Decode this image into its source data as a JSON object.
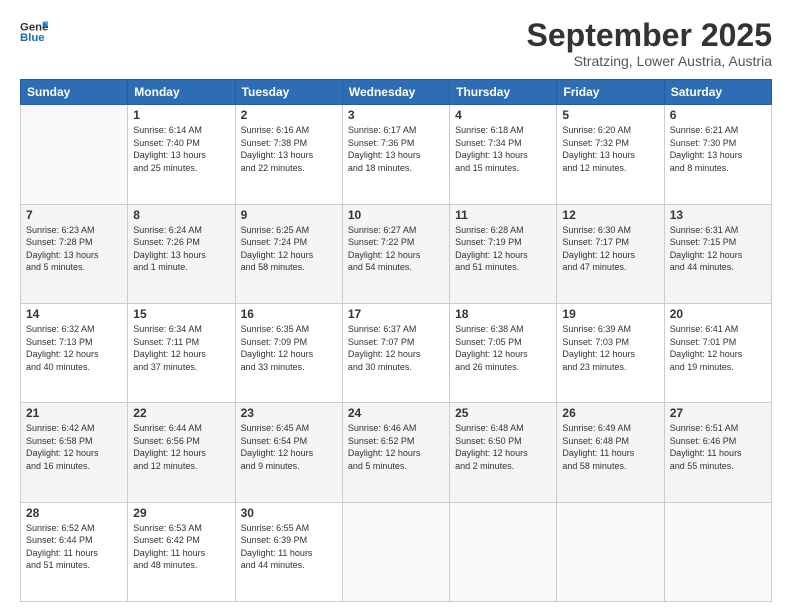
{
  "logo": {
    "line1": "General",
    "line2": "Blue"
  },
  "header": {
    "month": "September 2025",
    "location": "Stratzing, Lower Austria, Austria"
  },
  "weekdays": [
    "Sunday",
    "Monday",
    "Tuesday",
    "Wednesday",
    "Thursday",
    "Friday",
    "Saturday"
  ],
  "weeks": [
    [
      {
        "day": "",
        "info": ""
      },
      {
        "day": "1",
        "info": "Sunrise: 6:14 AM\nSunset: 7:40 PM\nDaylight: 13 hours\nand 25 minutes."
      },
      {
        "day": "2",
        "info": "Sunrise: 6:16 AM\nSunset: 7:38 PM\nDaylight: 13 hours\nand 22 minutes."
      },
      {
        "day": "3",
        "info": "Sunrise: 6:17 AM\nSunset: 7:36 PM\nDaylight: 13 hours\nand 18 minutes."
      },
      {
        "day": "4",
        "info": "Sunrise: 6:18 AM\nSunset: 7:34 PM\nDaylight: 13 hours\nand 15 minutes."
      },
      {
        "day": "5",
        "info": "Sunrise: 6:20 AM\nSunset: 7:32 PM\nDaylight: 13 hours\nand 12 minutes."
      },
      {
        "day": "6",
        "info": "Sunrise: 6:21 AM\nSunset: 7:30 PM\nDaylight: 13 hours\nand 8 minutes."
      }
    ],
    [
      {
        "day": "7",
        "info": "Sunrise: 6:23 AM\nSunset: 7:28 PM\nDaylight: 13 hours\nand 5 minutes."
      },
      {
        "day": "8",
        "info": "Sunrise: 6:24 AM\nSunset: 7:26 PM\nDaylight: 13 hours\nand 1 minute."
      },
      {
        "day": "9",
        "info": "Sunrise: 6:25 AM\nSunset: 7:24 PM\nDaylight: 12 hours\nand 58 minutes."
      },
      {
        "day": "10",
        "info": "Sunrise: 6:27 AM\nSunset: 7:22 PM\nDaylight: 12 hours\nand 54 minutes."
      },
      {
        "day": "11",
        "info": "Sunrise: 6:28 AM\nSunset: 7:19 PM\nDaylight: 12 hours\nand 51 minutes."
      },
      {
        "day": "12",
        "info": "Sunrise: 6:30 AM\nSunset: 7:17 PM\nDaylight: 12 hours\nand 47 minutes."
      },
      {
        "day": "13",
        "info": "Sunrise: 6:31 AM\nSunset: 7:15 PM\nDaylight: 12 hours\nand 44 minutes."
      }
    ],
    [
      {
        "day": "14",
        "info": "Sunrise: 6:32 AM\nSunset: 7:13 PM\nDaylight: 12 hours\nand 40 minutes."
      },
      {
        "day": "15",
        "info": "Sunrise: 6:34 AM\nSunset: 7:11 PM\nDaylight: 12 hours\nand 37 minutes."
      },
      {
        "day": "16",
        "info": "Sunrise: 6:35 AM\nSunset: 7:09 PM\nDaylight: 12 hours\nand 33 minutes."
      },
      {
        "day": "17",
        "info": "Sunrise: 6:37 AM\nSunset: 7:07 PM\nDaylight: 12 hours\nand 30 minutes."
      },
      {
        "day": "18",
        "info": "Sunrise: 6:38 AM\nSunset: 7:05 PM\nDaylight: 12 hours\nand 26 minutes."
      },
      {
        "day": "19",
        "info": "Sunrise: 6:39 AM\nSunset: 7:03 PM\nDaylight: 12 hours\nand 23 minutes."
      },
      {
        "day": "20",
        "info": "Sunrise: 6:41 AM\nSunset: 7:01 PM\nDaylight: 12 hours\nand 19 minutes."
      }
    ],
    [
      {
        "day": "21",
        "info": "Sunrise: 6:42 AM\nSunset: 6:58 PM\nDaylight: 12 hours\nand 16 minutes."
      },
      {
        "day": "22",
        "info": "Sunrise: 6:44 AM\nSunset: 6:56 PM\nDaylight: 12 hours\nand 12 minutes."
      },
      {
        "day": "23",
        "info": "Sunrise: 6:45 AM\nSunset: 6:54 PM\nDaylight: 12 hours\nand 9 minutes."
      },
      {
        "day": "24",
        "info": "Sunrise: 6:46 AM\nSunset: 6:52 PM\nDaylight: 12 hours\nand 5 minutes."
      },
      {
        "day": "25",
        "info": "Sunrise: 6:48 AM\nSunset: 6:50 PM\nDaylight: 12 hours\nand 2 minutes."
      },
      {
        "day": "26",
        "info": "Sunrise: 6:49 AM\nSunset: 6:48 PM\nDaylight: 11 hours\nand 58 minutes."
      },
      {
        "day": "27",
        "info": "Sunrise: 6:51 AM\nSunset: 6:46 PM\nDaylight: 11 hours\nand 55 minutes."
      }
    ],
    [
      {
        "day": "28",
        "info": "Sunrise: 6:52 AM\nSunset: 6:44 PM\nDaylight: 11 hours\nand 51 minutes."
      },
      {
        "day": "29",
        "info": "Sunrise: 6:53 AM\nSunset: 6:42 PM\nDaylight: 11 hours\nand 48 minutes."
      },
      {
        "day": "30",
        "info": "Sunrise: 6:55 AM\nSunset: 6:39 PM\nDaylight: 11 hours\nand 44 minutes."
      },
      {
        "day": "",
        "info": ""
      },
      {
        "day": "",
        "info": ""
      },
      {
        "day": "",
        "info": ""
      },
      {
        "day": "",
        "info": ""
      }
    ]
  ]
}
